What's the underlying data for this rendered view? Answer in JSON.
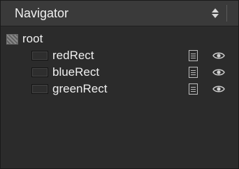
{
  "panel": {
    "title": "Navigator",
    "sort_icon": "up-down-arrows-icon"
  },
  "tree": {
    "root": {
      "label": "root",
      "icon": "hatched-layer-icon"
    },
    "children": [
      {
        "label": "redRect",
        "icon": "rectangle-icon",
        "doc_icon": "document-icon",
        "visibility_icon": "eye-icon"
      },
      {
        "label": "blueRect",
        "icon": "rectangle-icon",
        "doc_icon": "document-icon",
        "visibility_icon": "eye-icon"
      },
      {
        "label": "greenRect",
        "icon": "rectangle-icon",
        "doc_icon": "document-icon",
        "visibility_icon": "eye-icon"
      }
    ]
  },
  "colors": {
    "background": "#2b2b2b",
    "header": "#3a3a3a",
    "text": "#f0f0f0"
  }
}
